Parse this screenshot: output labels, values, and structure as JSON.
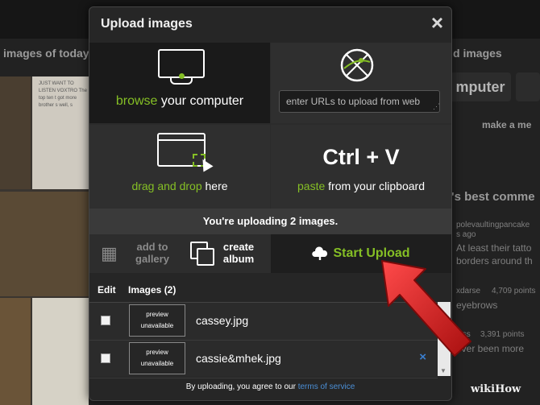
{
  "background": {
    "left_heading": "images of today,",
    "right_heading": "d images",
    "computer_button": "mputer",
    "make_link": "make a me",
    "best_comments": "'s best comme",
    "comments": [
      {
        "user": "polevaultingpancake",
        "meta": "s ago",
        "text": "At least their tatto borders around th"
      },
      {
        "user": "xdarse",
        "meta": "4,709 points",
        "text": "eyebrows"
      },
      {
        "user": "fyss",
        "meta": "3,391 points",
        "text": "ever been more"
      }
    ],
    "doc_snippet": "JUST WANT TO LISTEN VOXTRO The top ten t got more brother s well, s",
    "watermark": "wikiHow"
  },
  "modal": {
    "title": "Upload images",
    "close_label": "×",
    "browse": {
      "accent": "browse",
      "rest": " your computer"
    },
    "urls": {
      "placeholder": "enter URLs to upload from web"
    },
    "drag": {
      "accent": "drag and drop",
      "rest": " here"
    },
    "paste": {
      "shortcut": "Ctrl + V",
      "accent": "paste",
      "rest": " from your clipboard"
    },
    "status": "You're uploading 2 images.",
    "actions": {
      "gallery": "add to gallery",
      "album": "create album",
      "upload": "Start Upload"
    },
    "list": {
      "edit_header": "Edit",
      "images_header": "Images (2)",
      "preview_text": "preview unavailable",
      "remove_label": "×",
      "files": [
        {
          "name": "cassey.jpg"
        },
        {
          "name": "cassie&mhek.jpg"
        }
      ]
    },
    "footer": {
      "text": "By uploading, you agree to our ",
      "link": "terms of service"
    }
  },
  "colors": {
    "accent": "#85bf25",
    "link": "#4b8fd6",
    "arrow": "#cc1f1f"
  }
}
